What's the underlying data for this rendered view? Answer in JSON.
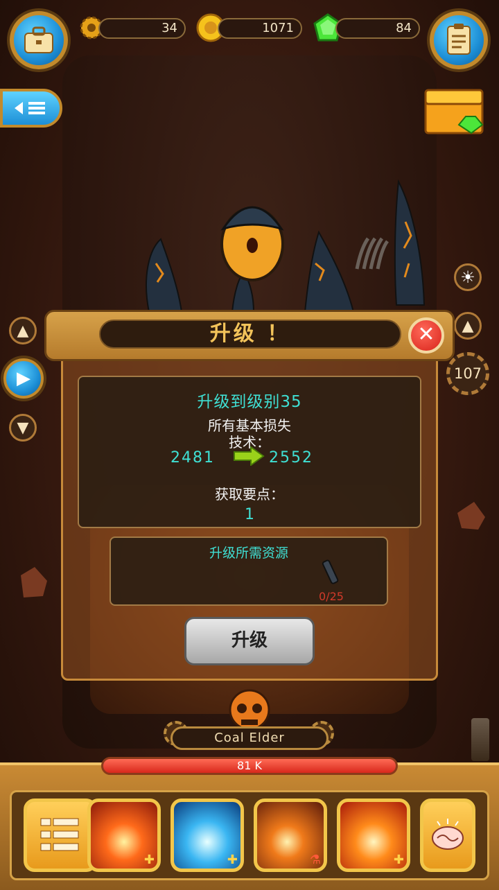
{
  "resources": {
    "gears": "34",
    "coins": "1071",
    "gems": "84"
  },
  "dialog": {
    "title": "升级 ！",
    "heading": "升级到级别35",
    "desc_line1": "所有基本损失",
    "desc_line2": "技术：",
    "value_from": "2481",
    "value_to": "2552",
    "points_label": "获取要点：",
    "points_value": "1",
    "resources_label": "升级所需资源",
    "resource_progress": "0/25",
    "upgrade_button": "升级"
  },
  "side": {
    "level_badge": "107"
  },
  "boss": {
    "name": "Coal Elder",
    "hp": "81 K"
  },
  "colors": {
    "accent_cyan": "#3fe0d4",
    "hp_red": "#d8281c",
    "frame_gold": "#c78a3a"
  },
  "icons": {
    "top_left": "briefcase-icon",
    "top_right": "clipboard-icon",
    "menu": "back-menu-icon",
    "chest": "treasure-chest-icon"
  }
}
